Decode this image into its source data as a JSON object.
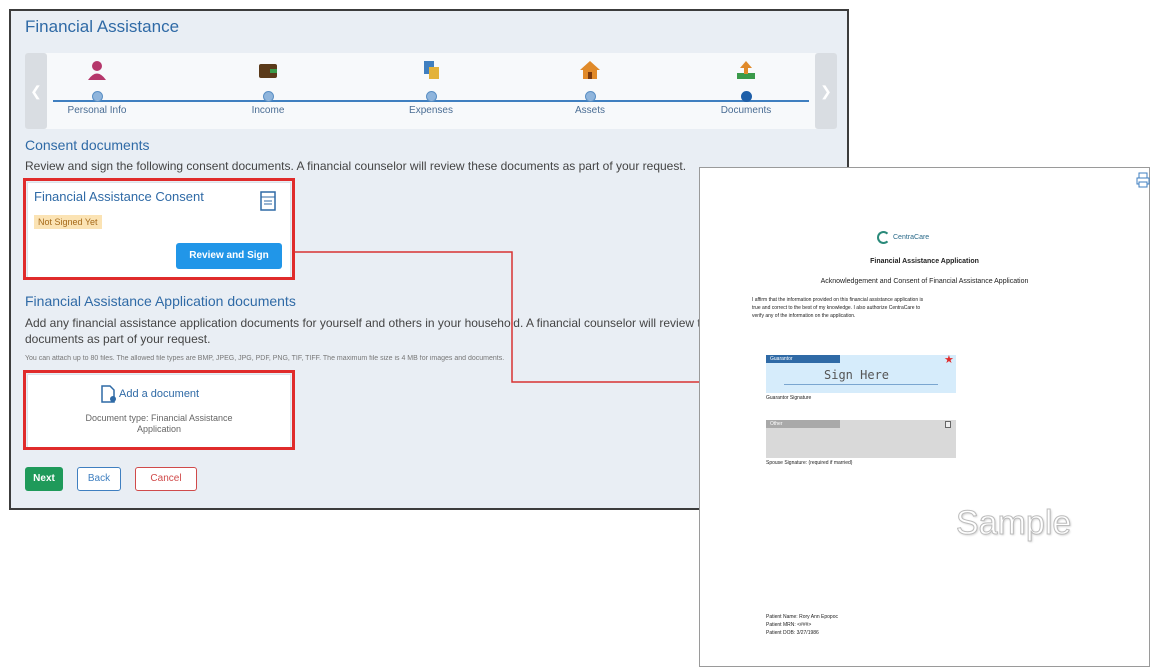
{
  "app": {
    "title": "Financial Assistance"
  },
  "stepper": {
    "steps": [
      {
        "label": "Personal Info",
        "icon": "person-icon",
        "color": "#b5376b"
      },
      {
        "label": "Income",
        "icon": "wallet-icon",
        "color": "#5a3a1a"
      },
      {
        "label": "Expenses",
        "icon": "receipt-icon",
        "color": "#3f7fc0"
      },
      {
        "label": "Assets",
        "icon": "house-icon",
        "color": "#e08a2a"
      },
      {
        "label": "Documents",
        "icon": "upload-icon",
        "color": "#3a9a4a"
      }
    ],
    "active_index": 4
  },
  "consent": {
    "heading": "Consent documents",
    "description": "Review and sign the following consent documents. A financial counselor will review these documents as part of your request.",
    "card_title": "Financial Assistance Consent",
    "status_badge": "Not Signed Yet",
    "review_button": "Review and Sign"
  },
  "application_docs": {
    "heading": "Financial Assistance Application documents",
    "description_line1": "Add any financial assistance application documents for yourself and others in your household. A financial counselor will review these",
    "description_line2": "documents as part of your request.",
    "limits_note": "You can attach up to 80 files. The allowed file types are BMP, JPEG, JPG, PDF, PNG, TIF, TIFF. The maximum file size is 4 MB for images and documents.",
    "add_label": "Add a document",
    "doc_type_line1": "Document type: Financial Assistance",
    "doc_type_line2": "Application"
  },
  "actions": {
    "next": "Next",
    "back": "Back",
    "cancel": "Cancel"
  },
  "document_preview": {
    "logo_text": "CentraCare",
    "title": "Financial Assistance Application",
    "subtitle": "Acknowledgement and Consent of Financial Assistance Application",
    "body_line1": "I affirm that the information provided on this financial assistance application is",
    "body_line2": "true and correct to the best of my knowledge. I also authorize CentraCare to",
    "body_line3": "verify any of the information on the application.",
    "guarantor_tag": "Guarantor",
    "sign_here": "Sign Here",
    "guarantor_caption": "Guarantor Signature",
    "other_tag": "Other",
    "spouse_caption": "Spouse Signature: (required if married)",
    "watermark": "Sample",
    "patient_name_label": "Patient Name:",
    "patient_name": "Rory Ann Epopoc",
    "patient_mrn_label": "Patient MRN:",
    "patient_mrn": "<###>",
    "patient_dob_label": "Patient DOB:",
    "patient_dob": "3/27/1986"
  },
  "colors": {
    "accent": "#2f6aa6",
    "highlight_red": "#e02b2b",
    "next_green": "#1f9a5a",
    "review_blue": "#2196e8",
    "badge_bg": "#fbe3b4"
  }
}
